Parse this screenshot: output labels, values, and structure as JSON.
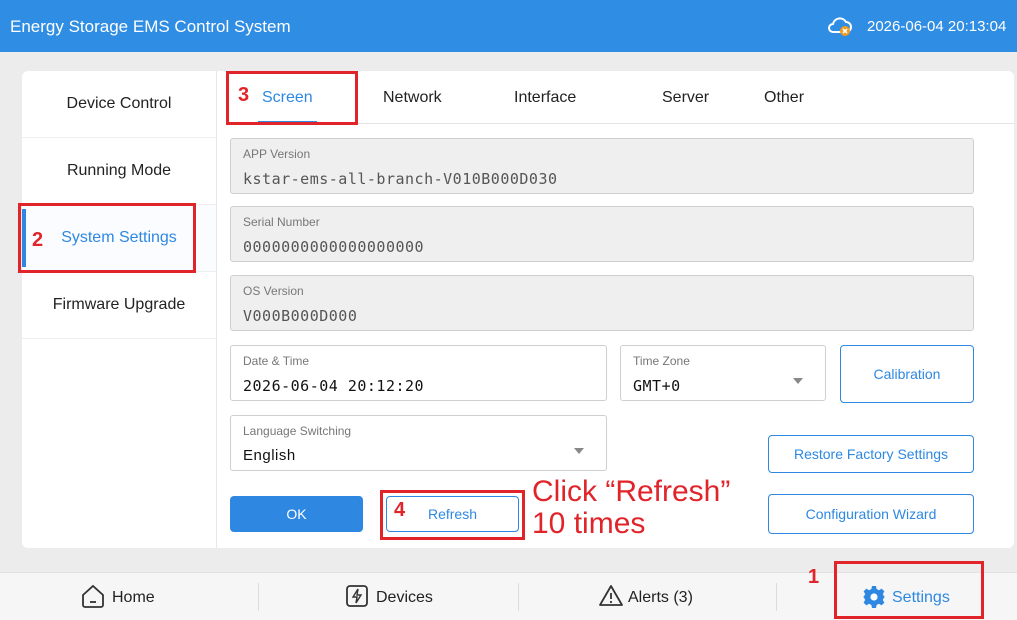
{
  "header": {
    "title": "Energy Storage EMS Control System",
    "datetime": "2026-06-04 20:13:04",
    "cloud_status_icon": "cloud-warning-icon"
  },
  "sidebar": {
    "items": [
      {
        "label": "Device Control"
      },
      {
        "label": "Running Mode"
      },
      {
        "label": "System Settings",
        "active": true
      },
      {
        "label": "Firmware Upgrade"
      }
    ]
  },
  "tabs": [
    {
      "label": "Screen",
      "active": true
    },
    {
      "label": "Network"
    },
    {
      "label": "Interface"
    },
    {
      "label": "Server"
    },
    {
      "label": "Other"
    }
  ],
  "form": {
    "app_version": {
      "label": "APP Version",
      "value": "kstar-ems-all-branch-V010B000D030"
    },
    "serial_number": {
      "label": "Serial Number",
      "value": "0000000000000000000"
    },
    "os_version": {
      "label": "OS Version",
      "value": "V000B000D000"
    },
    "date_time": {
      "label": "Date & Time",
      "value": "2026-06-04 20:12:20"
    },
    "time_zone": {
      "label": "Time Zone",
      "value": "GMT+0"
    },
    "language": {
      "label": "Language Switching",
      "value": "English"
    }
  },
  "buttons": {
    "calibration": "Calibration",
    "restore_factory": "Restore Factory Settings",
    "ok": "OK",
    "refresh": "Refresh",
    "configuration_wizard": "Configuration Wizard"
  },
  "bottom_nav": [
    {
      "label": "Home",
      "icon": "home-icon"
    },
    {
      "label": "Devices",
      "icon": "devices-icon"
    },
    {
      "label": "Alerts (3)",
      "icon": "alert-icon"
    },
    {
      "label": "Settings",
      "icon": "gear-icon",
      "active": true
    }
  ],
  "annotations": {
    "step1": "1",
    "step2": "2",
    "step3": "3",
    "step4": "4",
    "instruction_line1": "Click “Refresh”",
    "instruction_line2": "10 times"
  },
  "colors": {
    "accent": "#2e88e2",
    "header_bg": "#2f8de4",
    "annotation_red": "#e0242a"
  }
}
